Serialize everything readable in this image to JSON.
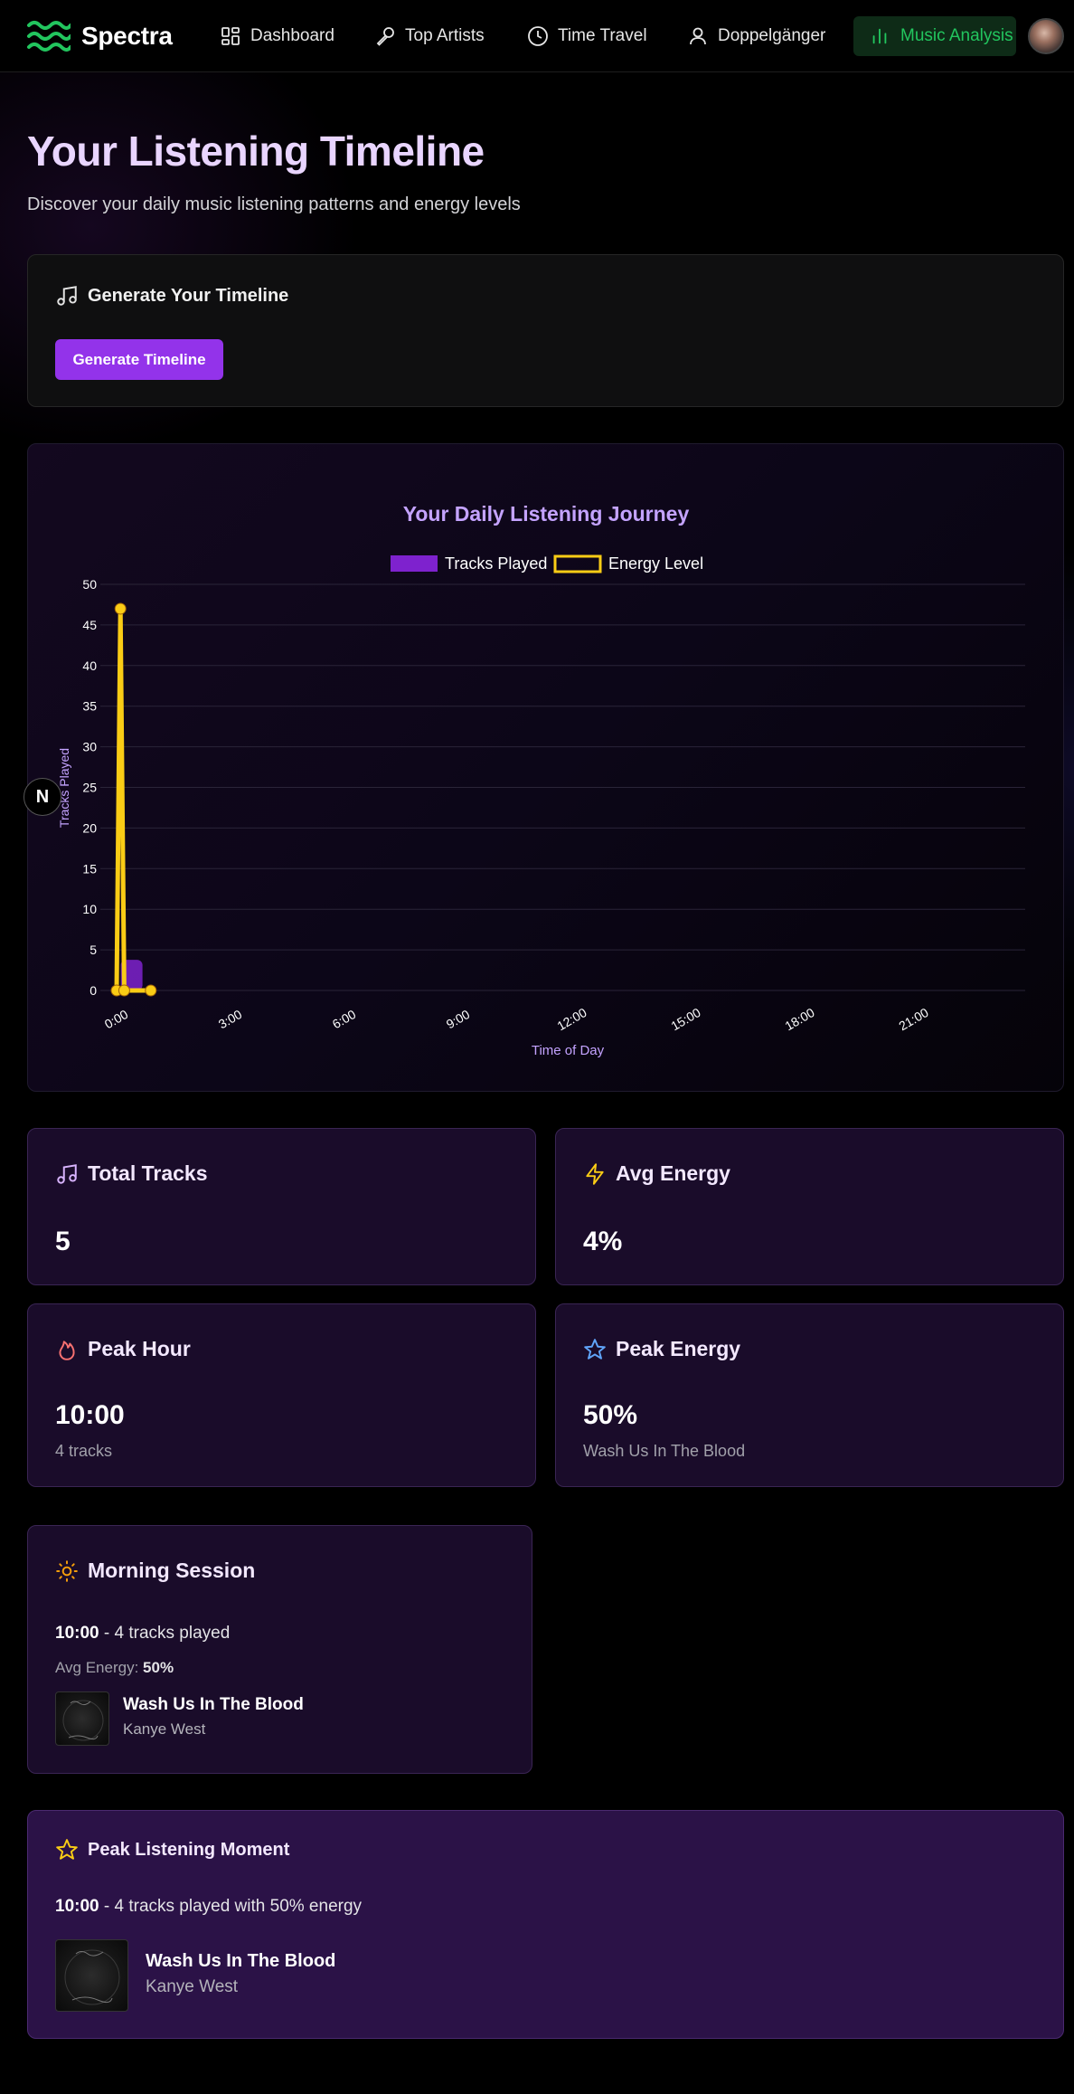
{
  "app": {
    "brand": "Spectra",
    "accent": "#9333ea",
    "active_color": "#22c55e"
  },
  "nav": {
    "items": [
      {
        "label": "Dashboard",
        "icon": "grid-icon"
      },
      {
        "label": "Top Artists",
        "icon": "microphone-icon"
      },
      {
        "label": "Time Travel",
        "icon": "clock-icon"
      },
      {
        "label": "Doppelgänger",
        "icon": "user-icon"
      }
    ],
    "active": {
      "label": "Music Analysis",
      "icon": "bar-chart-icon"
    }
  },
  "header": {
    "title": "Your Listening Timeline",
    "subtitle": "Discover your daily music listening patterns and energy levels"
  },
  "generate": {
    "title": "Generate Your Timeline",
    "button": "Generate Timeline"
  },
  "chart_data": {
    "type": "bar",
    "title": "Your Daily Listening Journey",
    "xlabel": "Time of Day",
    "ylabel": "Tracks Played",
    "ylim": [
      0,
      50
    ],
    "yticks": [
      0,
      5,
      10,
      15,
      20,
      25,
      30,
      35,
      40,
      45,
      50
    ],
    "x_tick_labels": [
      "0:00",
      "3:00",
      "6:00",
      "9:00",
      "12:00",
      "15:00",
      "18:00",
      "21:00"
    ],
    "legend_position": "top-center",
    "grid": true,
    "series": [
      {
        "name": "Tracks Played",
        "type": "bar",
        "color": "#7e22ce",
        "points": [
          {
            "x": 0.3,
            "y": 4
          }
        ]
      },
      {
        "name": "Energy Level",
        "type": "line",
        "color": "#facc15",
        "points": [
          {
            "x": 0,
            "y": 0
          },
          {
            "x": 0.1,
            "y": 47
          },
          {
            "x": 0.2,
            "y": 0
          },
          {
            "x": 0.9,
            "y": 0
          }
        ]
      }
    ]
  },
  "stats": {
    "total_tracks": {
      "label": "Total Tracks",
      "value": "5",
      "icon": "music-note-icon"
    },
    "avg_energy": {
      "label": "Avg Energy",
      "value": "4%",
      "icon": "lightning-icon"
    },
    "peak_hour": {
      "label": "Peak Hour",
      "value": "10:00",
      "sub": "4 tracks",
      "icon": "flame-icon"
    },
    "peak_energy": {
      "label": "Peak Energy",
      "value": "50%",
      "sub": "Wash Us In The Blood",
      "icon": "star-icon"
    }
  },
  "session": {
    "title": "Morning Session",
    "time": "10:00",
    "tracks_text": " - 4 tracks played",
    "energy_label": "Avg Energy: ",
    "energy_value": "50%",
    "track": {
      "title": "Wash Us In The Blood",
      "artist": "Kanye West"
    }
  },
  "peak": {
    "title": "Peak Listening Moment",
    "time": "10:00",
    "text": " - 4 tracks played with 50% energy",
    "track": {
      "title": "Wash Us In The Blood",
      "artist": "Kanye West"
    }
  },
  "badge": {
    "letter": "N"
  }
}
